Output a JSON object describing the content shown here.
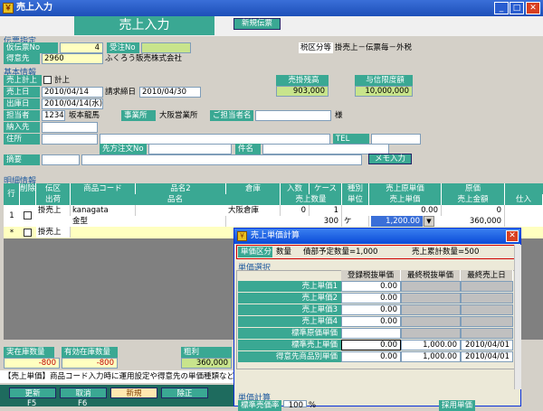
{
  "window": {
    "title": "売上入力",
    "minimize": "_",
    "maximize": "□",
    "close": "✕"
  },
  "header": {
    "title": "売上入力",
    "new_slip": "新規伝票"
  },
  "slip": {
    "section": "伝票指定",
    "kari_label": "仮伝票No",
    "kari_value": "4",
    "juchu_label": "受注No",
    "zeikubun_label": "税区分等",
    "zeikubun_value": "掛売上－伝票毎－外税",
    "tokuisaki_label": "得意先",
    "tokuisaki_code": "2960",
    "tokuisaki_name": "ふくろう販売株式会社"
  },
  "basic": {
    "section": "基本情報",
    "keijo_label": "売上計上",
    "keijo_check": "計上",
    "zandaka_label": "売掛残高",
    "zandaka_value": "903,000",
    "yoshin_label": "与信限度額",
    "yoshin_value": "10,000,000",
    "uriagebi_label": "売上日",
    "uriagebi_value": "2010/04/14",
    "seikyu_label": "請求締日",
    "seikyu_value": "2010/04/30",
    "shukka_label": "出庫日",
    "shukka_value": "2010/04/14(水)",
    "tanto_label": "担当者",
    "tanto_code": "1234",
    "tanto_name": "坂本龍馬",
    "jigyosho_label": "事業所",
    "jigyosho_value": "大阪営業所",
    "gotanto_label": "ご担当者名",
    "sama": "様",
    "nonyu_label": "納入先",
    "jusho_label": "住所",
    "tel_label": "TEL",
    "sakichumon_label": "先方注文No",
    "kenmei_label": "件名",
    "tekiyo_label": "摘要",
    "memo_btn": "メモ入力"
  },
  "detail": {
    "section": "明細情報",
    "head1": [
      "行No",
      "削除",
      "伝区",
      "商品コード",
      "品名2",
      "倉庫",
      "入数",
      "ケース",
      "種別",
      "売上原単価",
      "原価"
    ],
    "head2": [
      "出荷",
      "品名",
      "売上数量",
      "単位",
      "売上単価",
      "売上金額",
      "仕入"
    ],
    "row1": {
      "no": "1",
      "denku": "掛売上",
      "code": "kanagata",
      "soko": "大阪倉庫",
      "irisu": "0",
      "case": "1",
      "genka": "0.00",
      "kin1": "0",
      "hinmei": "金型",
      "suryo": "300",
      "tani": "ケ",
      "tanka": "1,200.00",
      "kingaku": "360,000"
    },
    "row2": {
      "mark": "*",
      "denku": "掛売上"
    }
  },
  "footer": {
    "zaiko_label": "実在庫数量",
    "zaiko_value": "-800",
    "yuko_label": "有効在庫数量",
    "yuko_value": "-800",
    "arari_label": "粗利",
    "arari_value": "360,000"
  },
  "message": "【売上単価】商品コード入力時に運用設定や得意先の単価種類などに",
  "fkeys": [
    {
      "label": "更新",
      "key": "F5"
    },
    {
      "label": "取消",
      "key": "F6"
    },
    {
      "label": "新規",
      "key": ""
    },
    {
      "label": "除正",
      "key": ""
    }
  ],
  "dialog": {
    "title": "売上単価計算",
    "kubun_label": "単価区分",
    "kubun_value": "数量",
    "yotei": "債部予定数量=1,000",
    "ruikei": "売上累計数量=500",
    "sentaku": "単価選択",
    "cols": [
      "登録税抜単価",
      "最終税抜単価",
      "最終売上日"
    ],
    "rows": [
      {
        "label": "売上単価1",
        "v1": "0.00",
        "v2": "",
        "v3": ""
      },
      {
        "label": "売上単価2",
        "v1": "0.00",
        "v2": "",
        "v3": ""
      },
      {
        "label": "売上単価3",
        "v1": "0.00",
        "v2": "",
        "v3": ""
      },
      {
        "label": "売上単価4",
        "v1": "0.00",
        "v2": "",
        "v3": ""
      },
      {
        "label": "標準原価単価",
        "v1": "",
        "v2": "",
        "v3": ""
      },
      {
        "label": "標準売上単価",
        "v1": "0.00",
        "v2": "1,000.00",
        "v3": "2010/04/01"
      },
      {
        "label": "得意先商品別単価",
        "v1": "0.00",
        "v2": "1,000.00",
        "v3": "2010/04/01"
      }
    ],
    "keisan": "単価計算",
    "kakeritsu_label": "標準売価率",
    "kakeritsu_value": "100",
    "pct": "%",
    "saiyou": "採用単価"
  }
}
